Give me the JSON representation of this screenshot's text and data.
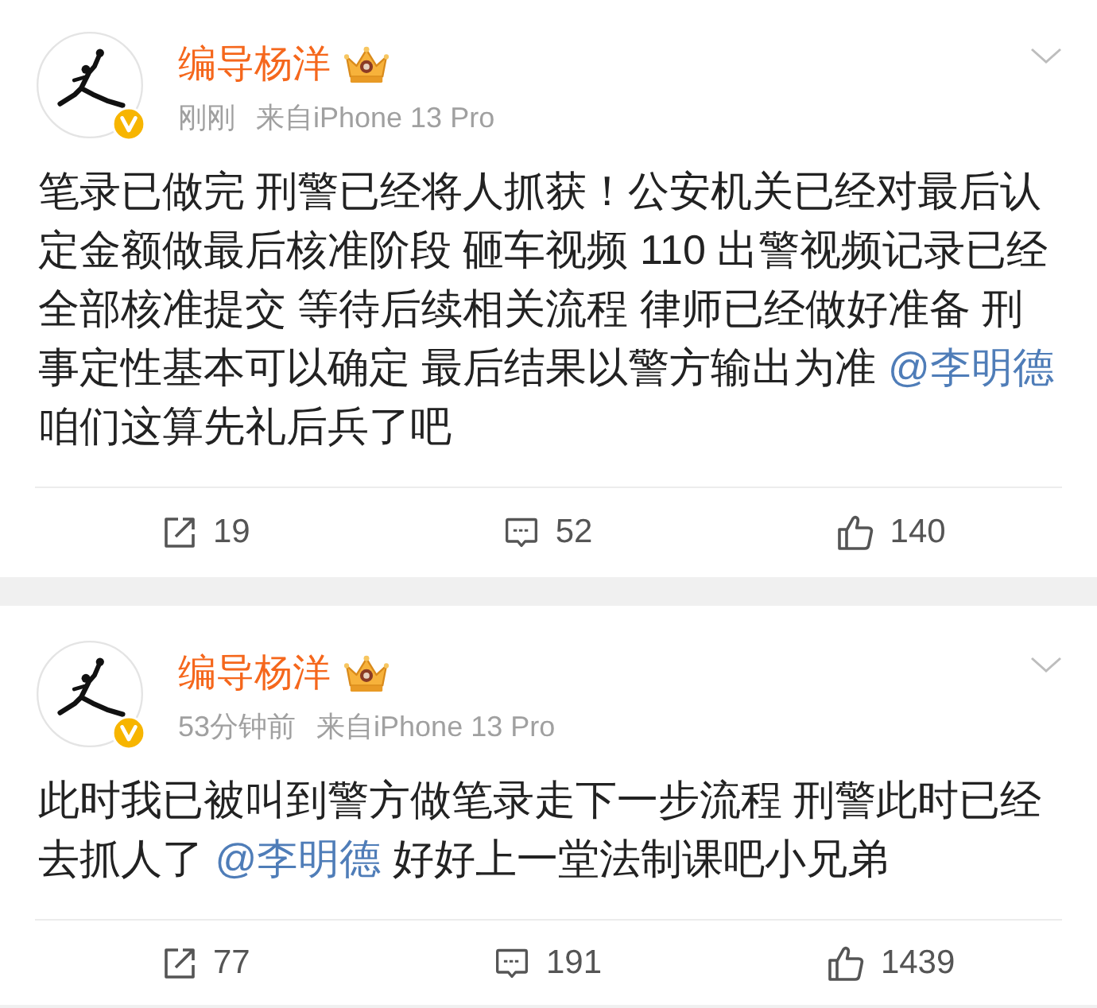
{
  "posts": [
    {
      "author": "编导杨洋",
      "vip": true,
      "verified": true,
      "time": "刚刚",
      "source": "来自iPhone 13 Pro",
      "body": [
        {
          "kind": "text",
          "text": "笔录已做完 刑警已经将人抓获！公安机关已经对最后认定金额做最后核准阶段 砸车视频 110 出警视频记录已经全部核准提交 等待后续相关流程 律师已经做好准备 刑事定性基本可以确定 最后结果以警方输出为准 "
        },
        {
          "kind": "mention",
          "text": "@李明德"
        },
        {
          "kind": "text",
          "text": " 咱们这算先礼后兵了吧"
        }
      ],
      "reposts": "19",
      "comments": "52",
      "likes": "140"
    },
    {
      "author": "编导杨洋",
      "vip": true,
      "verified": true,
      "time": "53分钟前",
      "source": "来自iPhone 13 Pro",
      "body": [
        {
          "kind": "text",
          "text": "此时我已被叫到警方做笔录走下一步流程 刑警此时已经去抓人了 "
        },
        {
          "kind": "mention",
          "text": "@李明德"
        },
        {
          "kind": "text",
          "text": " 好好上一堂法制课吧小兄弟"
        }
      ],
      "reposts": "77",
      "comments": "191",
      "likes": "1439"
    }
  ]
}
